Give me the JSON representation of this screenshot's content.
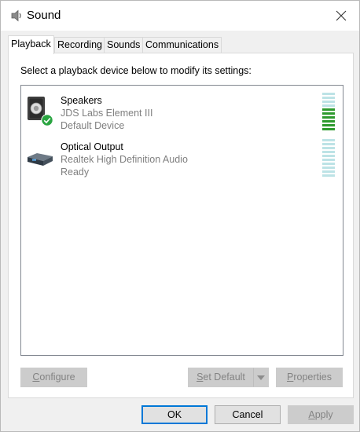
{
  "window": {
    "title": "Sound"
  },
  "tabs": [
    {
      "label": "Playback",
      "active": true
    },
    {
      "label": "Recording",
      "active": false
    },
    {
      "label": "Sounds",
      "active": false
    },
    {
      "label": "Communications",
      "active": false
    }
  ],
  "playback": {
    "instruction": "Select a playback device below to modify its settings:",
    "devices": [
      {
        "name": "Speakers",
        "description": "JDS Labs Element III",
        "status": "Default Device",
        "icon": "speaker-icon",
        "is_default": true,
        "level_fraction": 0.55
      },
      {
        "name": "Optical Output",
        "description": "Realtek High Definition Audio",
        "status": "Ready",
        "icon": "optical-output-icon",
        "is_default": false,
        "level_fraction": 0
      }
    ]
  },
  "buttons": {
    "configure": {
      "label": "Configure",
      "access_key": "C",
      "enabled": false
    },
    "set_default": {
      "label": "Set Default",
      "access_key": "S",
      "enabled": false
    },
    "properties": {
      "label": "Properties",
      "access_key": "P",
      "enabled": false
    },
    "ok": {
      "label": "OK",
      "enabled": true
    },
    "cancel": {
      "label": "Cancel",
      "enabled": true
    },
    "apply": {
      "label": "Apply",
      "access_key": "A",
      "enabled": false
    }
  },
  "colors": {
    "meter_active": "#2e9a2e",
    "meter_inactive": "#bde3e6",
    "default_check": "#2aa541",
    "accent": "#0078d7"
  }
}
